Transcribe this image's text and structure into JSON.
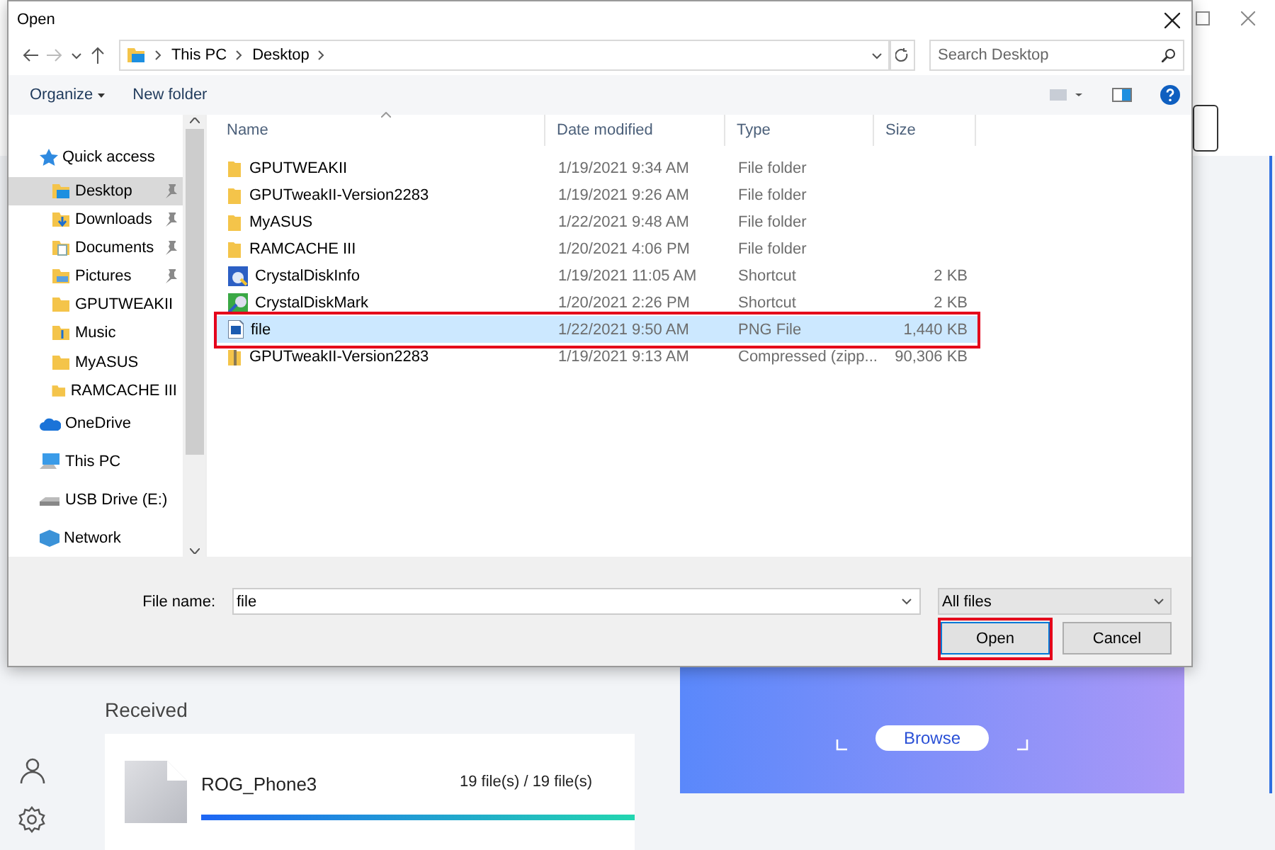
{
  "app": {
    "received_heading": "Received",
    "transfer": {
      "name": "ROG_Phone3",
      "count": "19 file(s) / 19 file(s)",
      "level": 1
    },
    "browse": "Browse"
  },
  "dialog": {
    "title": "Open",
    "breadcrumb": [
      "This PC",
      "Desktop"
    ],
    "search_placeholder": "Search Desktop",
    "toolbar": {
      "organize": "Organize",
      "new_folder": "New folder"
    },
    "nav": [
      {
        "label": "Quick access",
        "kind": "star",
        "selected": false,
        "children": [
          {
            "label": "Desktop",
            "kind": "desktop",
            "pinned": true,
            "selected": true
          },
          {
            "label": "Downloads",
            "kind": "downloads",
            "pinned": true,
            "selected": false
          },
          {
            "label": "Documents",
            "kind": "documents",
            "pinned": true,
            "selected": false
          },
          {
            "label": "Pictures",
            "kind": "pictures",
            "pinned": true,
            "selected": false
          },
          {
            "label": "GPUTWEAKII",
            "kind": "folder",
            "pinned": false,
            "selected": false
          },
          {
            "label": "Music",
            "kind": "music",
            "pinned": false,
            "selected": false
          },
          {
            "label": "MyASUS",
            "kind": "folder",
            "pinned": false,
            "selected": false
          },
          {
            "label": "RAMCACHE III",
            "kind": "folder",
            "pinned": false,
            "selected": false
          }
        ]
      },
      {
        "label": "OneDrive",
        "kind": "cloud",
        "selected": false
      },
      {
        "label": "This PC",
        "kind": "pc",
        "selected": false
      },
      {
        "label": "USB Drive (E:)",
        "kind": "drive",
        "selected": false
      },
      {
        "label": "Network",
        "kind": "network",
        "selected": false
      }
    ],
    "columns": [
      "Name",
      "Date modified",
      "Type",
      "Size"
    ],
    "files": [
      {
        "name": "GPUTWEAKII",
        "date": "1/19/2021 9:34 AM",
        "type": "File folder",
        "kind": "folder",
        "selected": false,
        "highlighted": false
      },
      {
        "name": "GPUTweakII-Version2283",
        "date": "1/19/2021 9:26 AM",
        "type": "File folder",
        "kind": "folder",
        "selected": false,
        "highlighted": false
      },
      {
        "name": "MyASUS",
        "date": "1/22/2021 9:48 AM",
        "type": "File folder",
        "kind": "folder",
        "selected": false,
        "highlighted": false
      },
      {
        "name": "RAMCACHE III",
        "date": "1/20/2021 4:06 PM",
        "type": "File folder",
        "kind": "folder",
        "selected": false,
        "highlighted": false
      },
      {
        "name": "CrystalDiskInfo",
        "date": "1/19/2021 11:05 AM",
        "type": "Shortcut",
        "size": "2 KB",
        "kind": "disk-shortcut",
        "selected": false,
        "highlighted": false
      },
      {
        "name": "CrystalDiskMark",
        "date": "1/20/2021 2:26 PM",
        "type": "Shortcut",
        "size": "2 KB",
        "kind": "mark-shortcut",
        "selected": false,
        "highlighted": false
      },
      {
        "name": "file",
        "date": "1/22/2021 9:50 AM",
        "type": "PNG File",
        "size": "1,440 KB",
        "kind": "image",
        "selected": true,
        "highlighted": true
      },
      {
        "name": "GPUTweakII-Version2283",
        "date": "1/19/2021 9:13 AM",
        "type": "Compressed (zipp...",
        "size": "90,306 KB",
        "kind": "zip",
        "selected": false,
        "highlighted": false
      }
    ],
    "file_name_label": "File name:",
    "file_name": "file",
    "filter": "All files",
    "buttons": [
      {
        "label": "Open",
        "default": true,
        "highlighted": true
      },
      {
        "label": "Cancel",
        "default": false,
        "highlighted": false
      }
    ]
  }
}
